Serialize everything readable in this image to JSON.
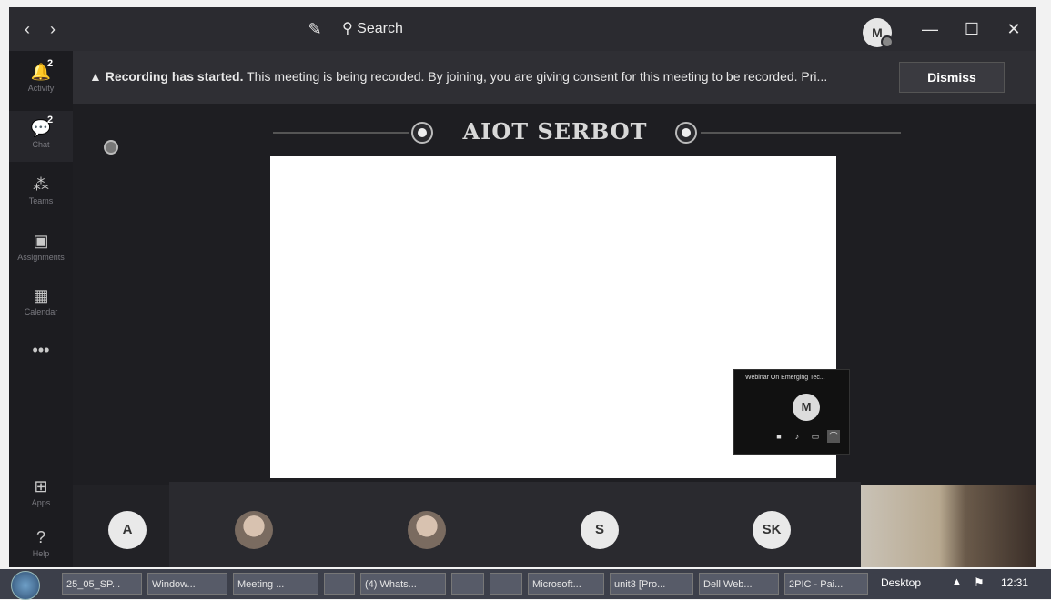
{
  "titlebar": {
    "back_icon": "‹",
    "forward_icon": "›",
    "compose_icon": "✎",
    "search_placeholder": "Search",
    "user_avatar": "M",
    "minimize_icon": "—",
    "maximize_icon": "☐",
    "close_icon": "✕"
  },
  "rail": [
    {
      "icon": "bell-icon",
      "glyph": "🔔",
      "label": "Activity",
      "badge": "2"
    },
    {
      "icon": "chat-icon",
      "glyph": "💬",
      "label": "Chat",
      "badge": "2"
    },
    {
      "icon": "teams-icon",
      "glyph": "⁂",
      "label": "Teams",
      "badge": ""
    },
    {
      "icon": "assignments-icon",
      "glyph": "▣",
      "label": "Assignments",
      "badge": ""
    },
    {
      "icon": "calendar-icon",
      "glyph": "▦",
      "label": "Calendar",
      "badge": ""
    },
    {
      "icon": "more-icon",
      "glyph": "•••",
      "label": "",
      "badge": ""
    },
    {
      "icon": "apps-icon",
      "glyph": "⊞",
      "label": "Apps",
      "badge": ""
    },
    {
      "icon": "help-icon",
      "glyph": "?",
      "label": "Help",
      "badge": ""
    }
  ],
  "banner": {
    "warning_icon": "▲",
    "bold_text": "Recording has started.",
    "text": " This meeting is being recorded. By joining, you are giving consent for this meeting to be recorded. Pri...",
    "dismiss_label": "Dismiss"
  },
  "stage": {
    "slide_title": "AIOT SERBOT"
  },
  "mini_window": {
    "title": "Webinar On Emerging Tec...",
    "avatar": "M"
  },
  "participants": [
    "A",
    "",
    "",
    "S",
    "SK"
  ],
  "taskbar": {
    "items": [
      "25_05_SP...",
      "Window...",
      "Meeting ...",
      "",
      "(4) Whats...",
      "",
      "",
      "Microsoft...",
      "unit3 [Pro...",
      "Dell Web...",
      "2PIC - Pai..."
    ],
    "desktop": "Desktop",
    "clock": "12:31"
  }
}
